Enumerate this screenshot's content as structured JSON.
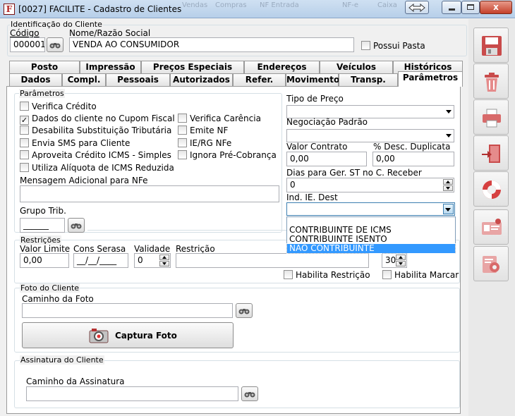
{
  "window": {
    "title": "[0027] FACILITE - Cadastro de Clientes",
    "app_icon": "F",
    "close_label": "x",
    "ghost_tabs": [
      "Vendas",
      "Compras",
      "NF Entrada",
      "NF-e",
      "Caixa"
    ]
  },
  "identification": {
    "group_title": "Identificação do Cliente",
    "code_label": "Código",
    "code_value": "000001",
    "name_label": "Nome/Razão Social",
    "name_value": "VENDA AO CONSUMIDOR",
    "possui_pasta_label": "Possui Pasta"
  },
  "tabs_row1": [
    "Posto",
    "Impressão",
    "Preços Especiais",
    "Endereços",
    "Veículos",
    "Históricos"
  ],
  "tabs_row2": [
    "Dados",
    "Compl.",
    "Pessoais",
    "Autorizados",
    "Refer.",
    "Movimento",
    "Transp.",
    "Parâmetros"
  ],
  "parametros": {
    "group_title": "Parâmetros",
    "checkboxes_left": [
      {
        "label": "Verifica Crédito",
        "checked": false
      },
      {
        "label": "Dados do cliente no Cupom Fiscal",
        "checked": true
      },
      {
        "label": "Desabilita Substituição Tributária",
        "checked": false
      },
      {
        "label": "Envia SMS para Cliente",
        "checked": false
      },
      {
        "label": "Aproveita Crédito ICMS - Simples",
        "checked": false
      },
      {
        "label": "Utiliza Alíquota de ICMS Reduzida",
        "checked": false
      }
    ],
    "checkboxes_right": [
      {
        "label": "Verifica Carência",
        "checked": false
      },
      {
        "label": "Emite NF",
        "checked": false
      },
      {
        "label": "IE/RG NFe",
        "checked": false
      },
      {
        "label": "Ignora Pré-Cobrança",
        "checked": false
      }
    ],
    "mensagem_label": "Mensagem Adicional para NFe",
    "mensagem_value": "",
    "grupo_trib_label": "Grupo Trib.",
    "grupo_trib_value": "______"
  },
  "right_panel": {
    "tipo_preco_label": "Tipo de Preço",
    "tipo_preco_value": "",
    "negociacao_label": "Negociação Padrão",
    "negociacao_value": "",
    "valor_contrato_label": "Valor Contrato",
    "valor_contrato_value": "0,00",
    "desc_duplicata_label": "% Desc. Duplicata",
    "desc_duplicata_value": "0,00",
    "dias_st_label": "Dias para Ger. ST no C. Receber",
    "dias_st_value": "0",
    "ind_ie_label": "Ind. IE. Dest",
    "ind_ie_value": "",
    "ind_ie_options": [
      "CONTRIBUINTE DE ICMS",
      "CONTRIBUINTE ISENTO",
      "NÃO CONTRIBUINTE"
    ],
    "ind_ie_highlighted": "NÃO CONTRIBUINTE"
  },
  "restricoes": {
    "group_title": "Restrições",
    "valor_limite_label": "Valor Limite",
    "valor_limite_value": "0,00",
    "cons_serasa_label": "Cons Serasa",
    "cons_serasa_value": "__/__/____",
    "validade_label": "Validade",
    "validade_value": "0",
    "restricao_label": "Restrição",
    "restricao_value": "",
    "habilita_restricao_label": "Habilita Restrição",
    "marcar_value": "30",
    "habilita_marcar_label": "Habilita Marcar"
  },
  "foto": {
    "group_title": "Foto do Cliente",
    "caminho_label": "Caminho da Foto",
    "caminho_value": "",
    "capture_label": "Captura Foto"
  },
  "assinatura": {
    "group_title": "Assinatura do Cliente",
    "caminho_label": "Caminho da Assinatura",
    "caminho_value": ""
  },
  "toolbar_icons": [
    "save-icon",
    "trash-icon",
    "printer-icon",
    "exit-door-icon",
    "lifebuoy-icon",
    "id-card-icon",
    "settings-icon"
  ],
  "colors": {
    "highlight": "#3399ff",
    "title_bar": "#b7cfe9",
    "close_button": "#c4402a"
  }
}
